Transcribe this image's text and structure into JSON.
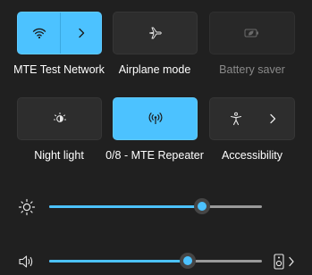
{
  "tiles": [
    {
      "label": "MTE Test Network",
      "state": "on",
      "icon": "wifi-icon",
      "secondary_icon": "chevron-right-icon"
    },
    {
      "label": "Airplane mode",
      "state": "off",
      "icon": "airplane-icon"
    },
    {
      "label": "Battery saver",
      "state": "disabled",
      "icon": "battery-saver-icon"
    },
    {
      "label": "Night light",
      "state": "off",
      "icon": "night-light-icon"
    },
    {
      "label": "0/8 - MTE Repeater",
      "state": "on",
      "icon": "mobile-hotspot-icon"
    },
    {
      "label": "Accessibility",
      "state": "off",
      "icon": "accessibility-icon",
      "secondary_icon": "chevron-right-icon"
    }
  ],
  "brightness": {
    "icon": "brightness-icon",
    "value": 0.72
  },
  "volume": {
    "icon": "speaker-icon",
    "value": 0.65,
    "output_icon": "speaker-device-icon",
    "output_chevron": "chevron-right-icon"
  },
  "colors": {
    "accent": "#4cc2ff",
    "tile_dark": "#2d2d2d",
    "background": "#202020"
  }
}
